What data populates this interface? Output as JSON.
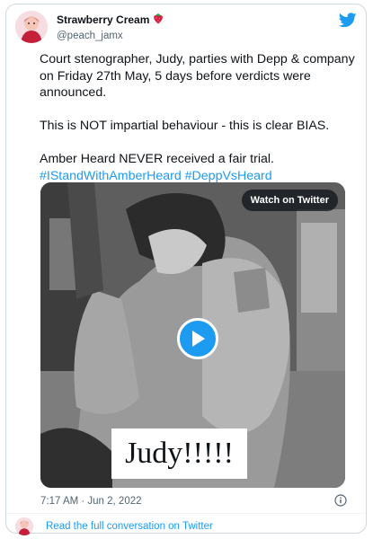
{
  "author": {
    "display_name": "Strawberry Cream",
    "name_emoji": "strawberry-emoji",
    "handle": "@peach_jamx"
  },
  "tweet": {
    "paragraphs": [
      "Court stenographer, Judy, parties with Depp & company on Friday 27th May, 5 days before verdicts were announced.",
      "This is NOT impartial behaviour - this is clear BIAS."
    ],
    "last_line": "Amber Heard NEVER received a fair trial.",
    "hashtags": "#IStandWithAmberHeard #DeppVsHeard"
  },
  "media": {
    "watch_label": "Watch on Twitter",
    "overlay_caption": "Judy!!!!!"
  },
  "meta": {
    "timestamp": "7:17 AM · Jun 2, 2022",
    "info_icon": "info-icon"
  },
  "footer": {
    "link_label": "Read the full conversation on Twitter"
  },
  "colors": {
    "accent": "#1d9bf0",
    "text": "#0f1419",
    "muted": "#536471",
    "border": "#cfd9de"
  }
}
